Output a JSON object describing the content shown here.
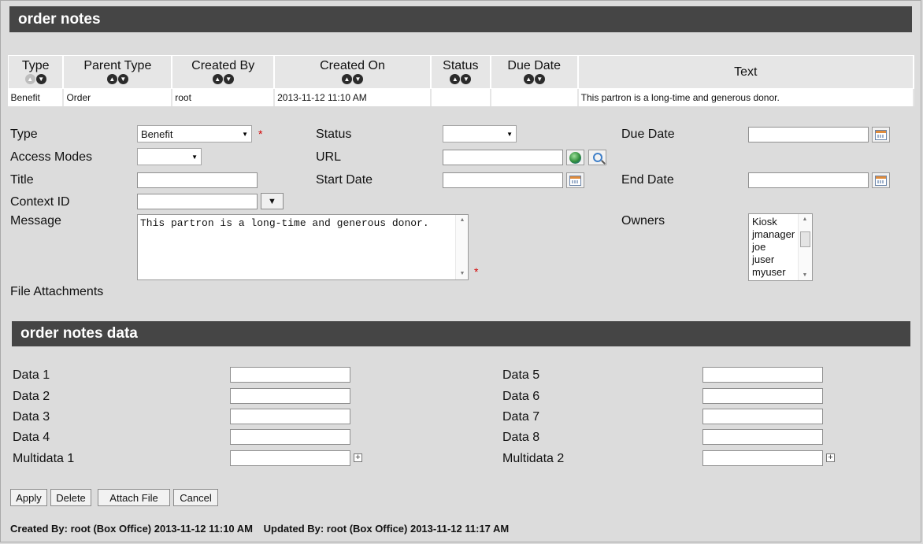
{
  "section1": {
    "title": "order notes"
  },
  "table": {
    "headers": [
      "Type",
      "Parent Type",
      "Created By",
      "Created On",
      "Status",
      "Due Date",
      "Text"
    ],
    "row": [
      "Benefit",
      "Order",
      "root",
      "2013-11-12 11:10 AM",
      "",
      "",
      "This partron is a long-time and generous donor."
    ]
  },
  "form": {
    "type_label": "Type",
    "type_value": "Benefit",
    "status_label": "Status",
    "status_value": "",
    "due_date_label": "Due Date",
    "access_modes_label": "Access Modes",
    "access_modes_value": "",
    "url_label": "URL",
    "title_label": "Title",
    "start_date_label": "Start Date",
    "end_date_label": "End Date",
    "context_id_label": "Context ID",
    "message_label": "Message",
    "message_value": "This partron is a long-time and generous donor.",
    "owners_label": "Owners",
    "owners": [
      "Kiosk",
      "jmanager",
      "joe",
      "juser",
      "myuser"
    ],
    "file_attachments_label": "File Attachments",
    "required_mark": "*"
  },
  "section2": {
    "title": "order notes data",
    "left_labels": [
      "Data 1",
      "Data 2",
      "Data 3",
      "Data 4",
      "Multidata 1"
    ],
    "right_labels": [
      "Data 5",
      "Data 6",
      "Data 7",
      "Data 8",
      "Multidata 2"
    ]
  },
  "buttons": {
    "apply": "Apply",
    "delete": "Delete",
    "attach": "Attach File",
    "cancel": "Cancel"
  },
  "footer": {
    "created": "Created By: root (Box Office) 2013-11-12 11:10 AM",
    "updated": "Updated By: root (Box Office) 2013-11-12 11:17 AM"
  }
}
